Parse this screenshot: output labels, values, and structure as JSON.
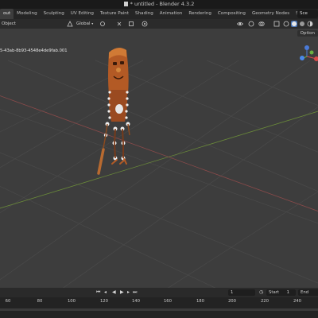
{
  "window": {
    "title": "* untitled - Blender 4.3.2"
  },
  "workspaces": [
    "out",
    "Modeling",
    "Sculpting",
    "UV Editing",
    "Texture Paint",
    "Shading",
    "Animation",
    "Rendering",
    "Compositing",
    "Geometry Nodes",
    "Scripting"
  ],
  "active_workspace_index": 0,
  "add_workspace_label": "+",
  "scene_label": "Sce",
  "toolbar": {
    "mode_label": "Object",
    "orientation_label": "Global",
    "options_label": "Option"
  },
  "viewport": {
    "object_name": "5-43ab-8b93-4548e4de9fab.001",
    "colors": {
      "background": "#3d3d3d",
      "grid": "#4a4a4a",
      "x_axis": "#8a4a4a",
      "y_axis": "#6a8a3a"
    }
  },
  "timeline": {
    "current_frame": "1",
    "start_label": "Start",
    "start_value": "1",
    "end_label": "End",
    "end_value": "250"
  },
  "ruler": {
    "ticks": [
      "60",
      "80",
      "100",
      "120",
      "140",
      "160",
      "180",
      "200",
      "220",
      "240"
    ]
  }
}
